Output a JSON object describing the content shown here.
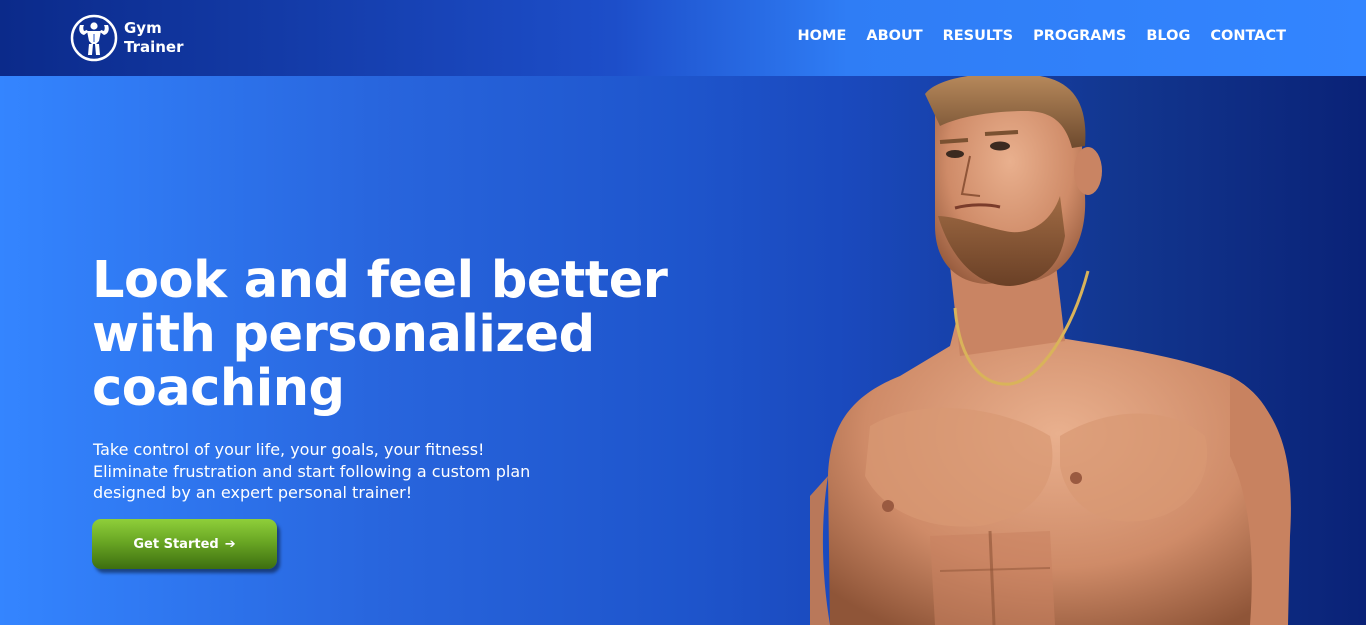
{
  "brand": {
    "line1": "Gym",
    "line2": "Trainer",
    "logo_icon": "bodybuilder-logo-icon"
  },
  "nav": {
    "items": [
      {
        "label": "HOME"
      },
      {
        "label": "ABOUT"
      },
      {
        "label": "RESULTS"
      },
      {
        "label": "PROGRAMS"
      },
      {
        "label": "BLOG"
      },
      {
        "label": "CONTACT"
      }
    ]
  },
  "hero": {
    "headline_line1": "Look and feel better",
    "headline_line2": "with personalized",
    "headline_line3": "coaching",
    "sub_line1": "Take control of your life, your goals, your fitness!",
    "sub_line2": "Eliminate frustration and start following a custom plan",
    "sub_line3": "designed by an expert personal trainer!",
    "cta_label": "Get Started",
    "cta_icon": "arrow-right-icon",
    "image": "shirtless-trainer-photo"
  },
  "colors": {
    "nav_gradient_start": "#0b2a8a",
    "nav_gradient_end": "#3385ff",
    "hero_gradient_start": "#3485ff",
    "hero_gradient_end": "#0a2277",
    "cta_green": "#6aa724",
    "text": "#ffffff"
  }
}
